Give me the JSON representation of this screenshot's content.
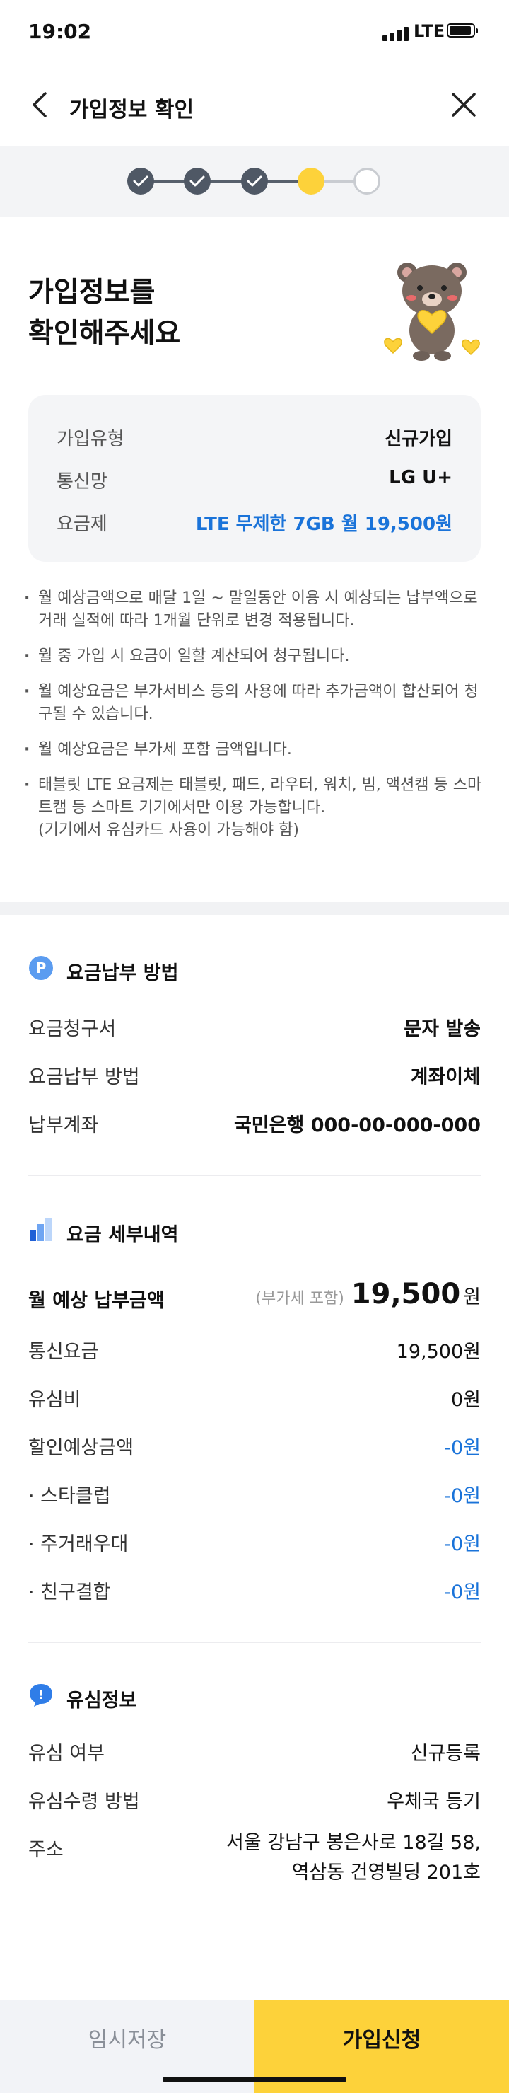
{
  "status": {
    "time": "19:02",
    "network": "LTE"
  },
  "nav": {
    "title": "가입정보 확인"
  },
  "stepper": {
    "total_steps": 5,
    "current_step": 4
  },
  "headline": {
    "line1": "가입정보를",
    "line2": "확인해주세요"
  },
  "summary": {
    "rows": [
      {
        "label": "가입유형",
        "value": "신규가입"
      },
      {
        "label": "통신망",
        "value": "LG U+"
      },
      {
        "label": "요금제",
        "value": "LTE 무제한 7GB  월 19,500원"
      }
    ]
  },
  "notes": [
    "월 예상금액으로 매달 1일 ~ 말일동안 이용 시 예상되는 납부액으로 거래 실적에 따라 1개월 단위로 변경 적용됩니다.",
    "월 중 가입 시 요금이 일할 계산되어 청구됩니다.",
    "월 예상요금은 부가서비스 등의 사용에 따라 추가금액이 합산되어 청구될 수 있습니다.",
    "월 예상요금은 부가세 포함 금액입니다.",
    "태블릿 LTE 요금제는 태블릿, 패드, 라우터, 워치, 빔, 액션캠 등 스마트캠 등 스마트 기기에서만 이용 가능합니다.\n(기기에서 유심카드 사용이 가능해야 함)"
  ],
  "payment": {
    "title": "요금납부 방법",
    "icon_letter": "P",
    "rows": [
      {
        "label": "요금청구서",
        "value": "문자 발송"
      },
      {
        "label": "요금납부 방법",
        "value": "계좌이체"
      },
      {
        "label": "납부계좌",
        "value": "국민은행 000-00-000-000"
      }
    ]
  },
  "details": {
    "title": "요금 세부내역",
    "total_label": "월 예상 납부금액",
    "total_note": "(부가세 포함)",
    "total_amount": "19,500",
    "total_unit": "원",
    "rows": [
      {
        "label": "통신요금",
        "value": "19,500원"
      },
      {
        "label": "유심비",
        "value": "0원"
      },
      {
        "label": "할인예상금액",
        "value": "-0원"
      },
      {
        "label": "· 스타클럽",
        "value": "-0원"
      },
      {
        "label": "· 주거래우대",
        "value": "-0원"
      },
      {
        "label": "· 친구결합",
        "value": "-0원"
      }
    ]
  },
  "usim": {
    "title": "유심정보",
    "icon_letter": "!",
    "rows": [
      {
        "label": "유심 여부",
        "value": "신규등록"
      },
      {
        "label": "유심수령 방법",
        "value": "우체국 등기"
      }
    ],
    "address_label": "주소",
    "address_line1": "서울 강남구 봉은사로 18길 58,",
    "address_line2": "역삼동 건영빌딩 201호"
  },
  "actions": {
    "temp_save": "임시저장",
    "submit": "가입신청"
  },
  "colors": {
    "accent_yellow": "#fdd23a",
    "link_blue": "#1a73d9",
    "step_done": "#4f5865"
  }
}
